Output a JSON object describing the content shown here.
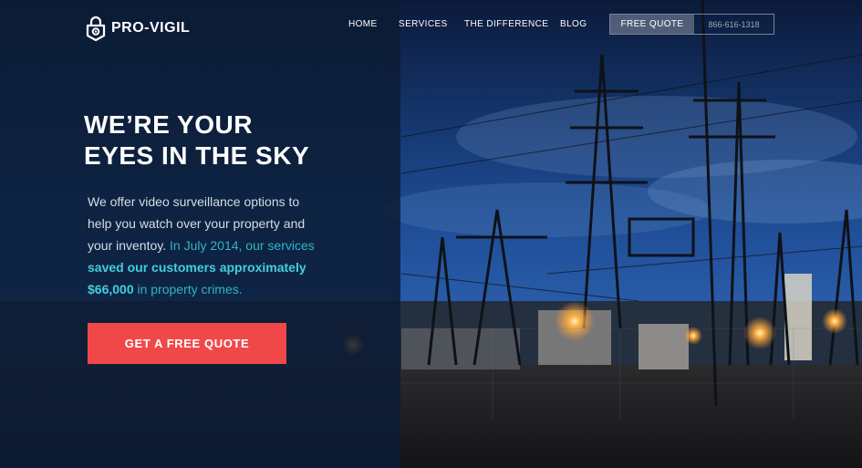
{
  "colors": {
    "overlay": "#0c1c34",
    "accent_teal": "#43cede",
    "cta_red": "#f04848",
    "sky_blue": "#1f4f9a"
  },
  "nav": {
    "brand": "PRO-VIGIL",
    "brand_icon": "lock-eye-icon",
    "links": [
      "HOME",
      "SERVICES",
      "THE DIFFERENCE",
      "BLOG"
    ],
    "quote_label": "FREE QUOTE",
    "phone": "866-616-1318"
  },
  "hero": {
    "headline_line1": "WE’RE YOUR",
    "headline_line2": "EYES IN THE SKY",
    "body": {
      "line1": "We offer video surveillance options to",
      "line2": "help you watch over your property and",
      "line3_plain": "your inventoy.",
      "line3_teal": " In July 2014, our services",
      "line4_bold": "saved our customers approximately",
      "line5_bold": "$66,000",
      "line5_teal": " in property crimes."
    },
    "cta_label": "GET A FREE QUOTE",
    "background": "night-power-substation-photo"
  }
}
